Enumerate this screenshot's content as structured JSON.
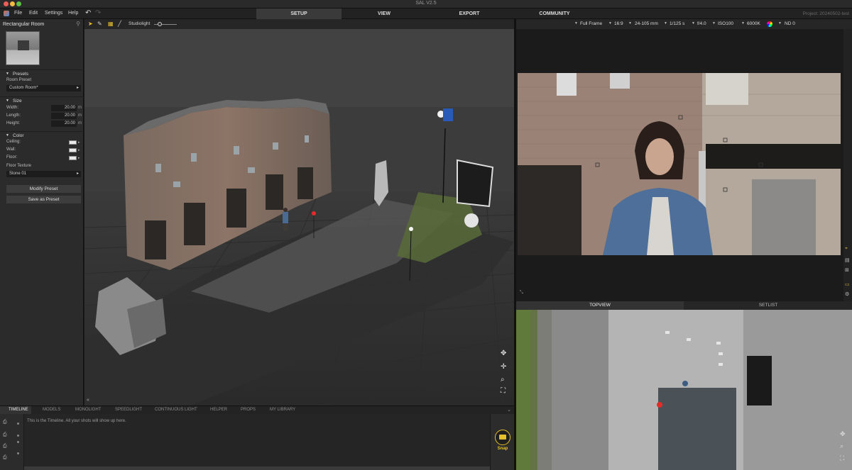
{
  "window": {
    "title": "SAL V2.5"
  },
  "menu": {
    "items": [
      "File",
      "Edit",
      "Settings",
      "Help"
    ],
    "main_tabs": [
      "SETUP",
      "VIEW",
      "EXPORT",
      "COMMUNITY"
    ],
    "active_tab": "SETUP",
    "project": "Project: 20240502-test"
  },
  "left_panel": {
    "title": "Rectangular Room",
    "presets": {
      "heading": "Presets",
      "room_preset_label": "Room Preset",
      "room_preset_value": "Custom Room*"
    },
    "size": {
      "heading": "Size",
      "fields": [
        {
          "label": "Width:",
          "value": "20.00",
          "unit": "m"
        },
        {
          "label": "Length:",
          "value": "20.00",
          "unit": "m"
        },
        {
          "label": "Height:",
          "value": "20.00",
          "unit": "m"
        }
      ]
    },
    "color": {
      "heading": "Color",
      "fields": [
        {
          "label": "Ceiling:",
          "swatch": "#e9e9e9"
        },
        {
          "label": "Wall:",
          "swatch": "#e9e9e9"
        },
        {
          "label": "Floor:",
          "swatch": "#e9e9e9"
        }
      ],
      "floor_texture_label": "Floor Texture",
      "floor_texture_value": "Stone 01"
    },
    "buttons": {
      "modify": "Modify Preset",
      "save": "Save as Preset"
    }
  },
  "viewport": {
    "tools": [
      "select-arrow-icon",
      "pen-icon",
      "grid-icon",
      "line-icon"
    ],
    "studiolight_label": "Studiolight",
    "studiolight_level": 0.25
  },
  "camera": {
    "sensor": "Full Frame",
    "aspect": "16:9",
    "lens": "24-105 mm",
    "shutter": "1/125 s",
    "aperture": "f/4.0",
    "iso": "ISO100",
    "white_balance": "6000K",
    "nd": "ND 0"
  },
  "topview": {
    "tabs": [
      "TOPVIEW",
      "SETLIST"
    ],
    "active": "TOPVIEW"
  },
  "bottom": {
    "tabs": [
      "TIMELINE",
      "MODELS",
      "MONOLIGHT",
      "SPEEDLIGHT",
      "CONTINUOUS LIGHT",
      "HELPER",
      "PROPS",
      "MY LIBRARY"
    ],
    "active": "TIMELINE",
    "timeline_text": "This is the Timeline. All your shots will show up here.",
    "snap_label": "Snap"
  },
  "colors": {
    "accent": "#e6c02b",
    "panel": "#2b2b2b",
    "background": "#1a1a1a"
  }
}
